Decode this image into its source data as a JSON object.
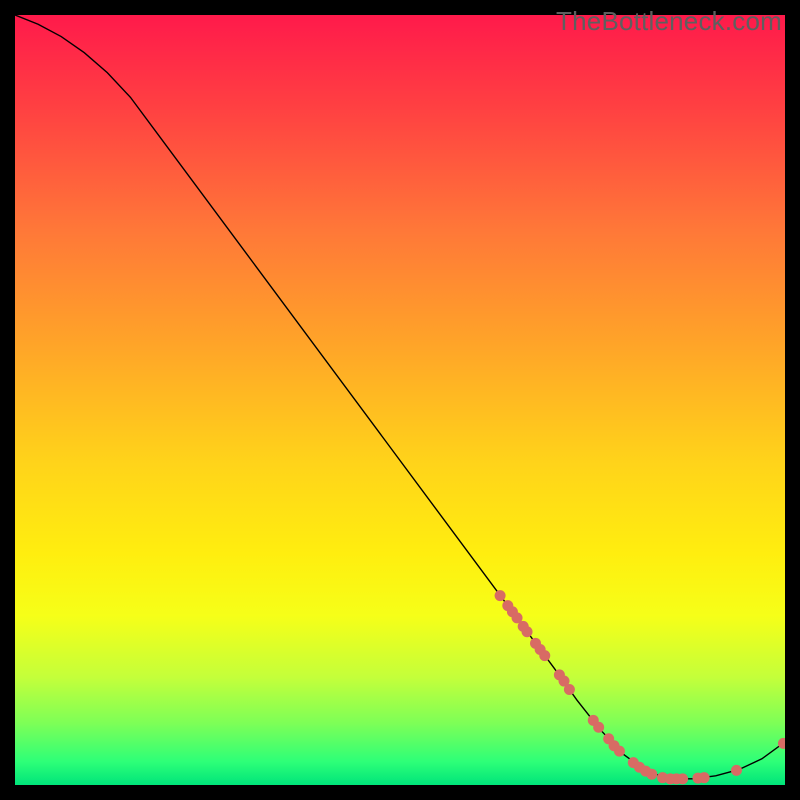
{
  "watermark": "TheBottleneck.com",
  "chart_data": {
    "type": "line",
    "title": "",
    "xlabel": "",
    "ylabel": "",
    "xlim": [
      0,
      100
    ],
    "ylim": [
      0,
      100
    ],
    "curve_xy": [
      [
        0.0,
        100.0
      ],
      [
        3.0,
        98.8
      ],
      [
        6.0,
        97.2
      ],
      [
        9.0,
        95.1
      ],
      [
        12.0,
        92.5
      ],
      [
        15.0,
        89.3
      ],
      [
        70.0,
        15.2
      ],
      [
        73.0,
        11.0
      ],
      [
        76.0,
        7.2
      ],
      [
        79.0,
        4.0
      ],
      [
        82.0,
        1.8
      ],
      [
        85.0,
        0.8
      ],
      [
        88.0,
        0.8
      ],
      [
        91.0,
        1.2
      ],
      [
        94.0,
        2.0
      ],
      [
        97.0,
        3.4
      ],
      [
        100.0,
        5.6
      ]
    ],
    "series": [
      {
        "name": "markers",
        "xy": [
          [
            63.0,
            24.6
          ],
          [
            64.0,
            23.3
          ],
          [
            64.6,
            22.5
          ],
          [
            65.2,
            21.7
          ],
          [
            66.0,
            20.6
          ],
          [
            66.5,
            19.9
          ],
          [
            67.6,
            18.4
          ],
          [
            68.2,
            17.6
          ],
          [
            68.8,
            16.8
          ],
          [
            70.7,
            14.3
          ],
          [
            71.3,
            13.5
          ],
          [
            72.0,
            12.4
          ],
          [
            75.1,
            8.4
          ],
          [
            75.8,
            7.5
          ],
          [
            77.1,
            6.0
          ],
          [
            77.8,
            5.1
          ],
          [
            78.5,
            4.4
          ],
          [
            80.3,
            2.9
          ],
          [
            81.1,
            2.3
          ],
          [
            81.9,
            1.8
          ],
          [
            82.7,
            1.4
          ],
          [
            84.1,
            0.95
          ],
          [
            85.1,
            0.8
          ],
          [
            85.9,
            0.8
          ],
          [
            86.7,
            0.8
          ],
          [
            88.7,
            0.9
          ],
          [
            89.5,
            0.95
          ],
          [
            93.7,
            1.9
          ],
          [
            99.8,
            5.4
          ]
        ]
      }
    ]
  }
}
